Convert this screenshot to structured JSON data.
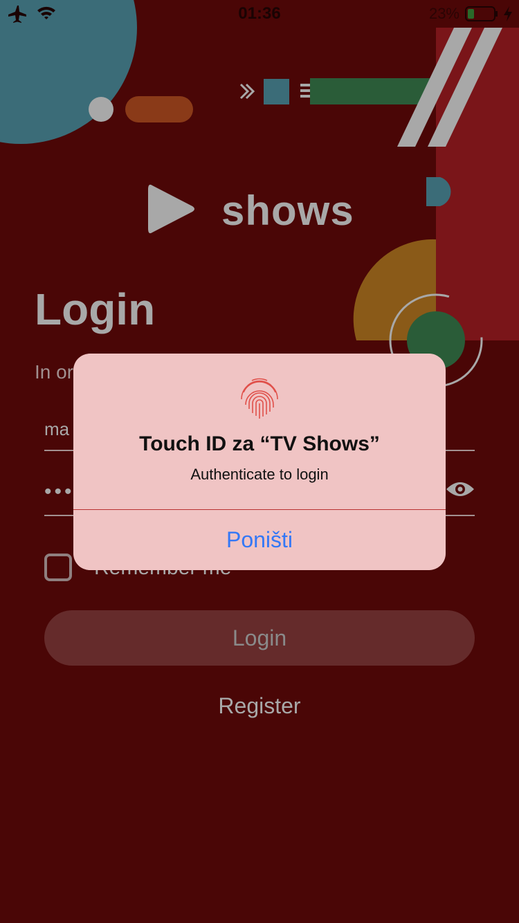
{
  "status_bar": {
    "time": "01:36",
    "battery_percent": "23%",
    "icons": [
      "airplane-icon",
      "wifi-icon",
      "battery-icon",
      "charging-bolt-icon"
    ]
  },
  "app": {
    "name": "shows",
    "logo_icon": "play-icon"
  },
  "login": {
    "title": "Login",
    "subtitle": "In or",
    "email_value": "ma",
    "password_dots": "•••",
    "show_password_icon": "eye-icon",
    "remember_label": "Remember me",
    "login_button": "Login",
    "register_link": "Register"
  },
  "alert": {
    "icon": "fingerprint-icon",
    "title": "Touch ID za “TV Shows”",
    "message": "Authenticate to login",
    "cancel_button": "Poništi"
  },
  "colors": {
    "background": "#4a0606",
    "alert_background": "#f0c4c4",
    "alert_button": "#3478f6",
    "login_button_bg": "#652b2b"
  }
}
